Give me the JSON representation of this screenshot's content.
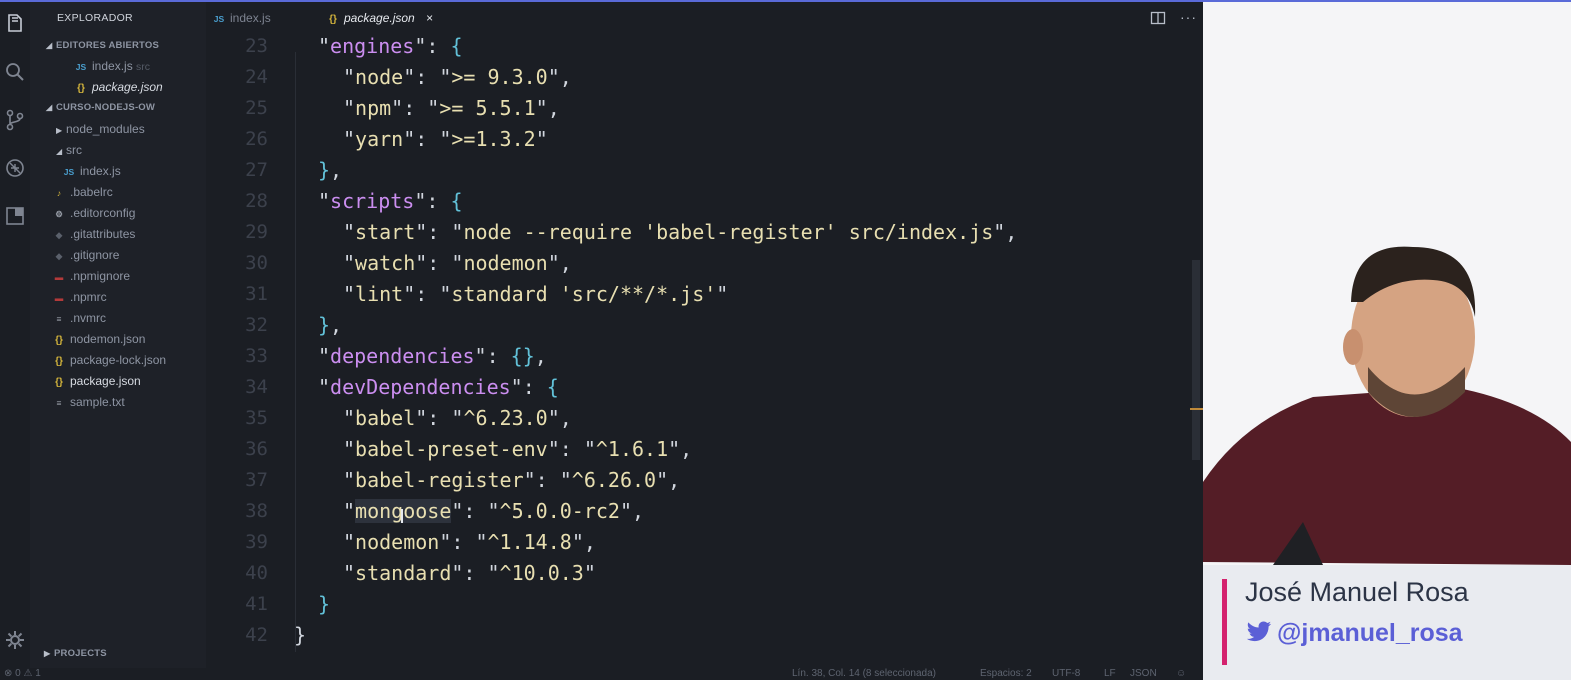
{
  "sidebar": {
    "title": "EXPLORADOR",
    "open_editors": {
      "label": "EDITORES ABIERTOS",
      "items": [
        {
          "icon": "js-file-icon",
          "name": "index.js",
          "detail": "src"
        },
        {
          "icon": "json-file-icon",
          "name": "package.json"
        }
      ]
    },
    "project": {
      "label": "CURSO-NODEJS-OW",
      "items": [
        {
          "name": "node_modules"
        },
        {
          "name": "src"
        },
        {
          "name": "index.js"
        },
        {
          "name": ".babelrc"
        },
        {
          "name": ".editorconfig"
        },
        {
          "name": ".gitattributes"
        },
        {
          "name": ".gitignore"
        },
        {
          "name": ".npmignore"
        },
        {
          "name": ".npmrc"
        },
        {
          "name": ".nvmrc"
        },
        {
          "name": "nodemon.json"
        },
        {
          "name": "package-lock.json"
        },
        {
          "name": "package.json"
        },
        {
          "name": "sample.txt"
        }
      ]
    },
    "projects_label": "PROJECTS"
  },
  "tabs": [
    {
      "label": "index.js",
      "icon": "js-file-icon",
      "active": false
    },
    {
      "label": "package.json",
      "icon": "json-file-icon",
      "active": true
    }
  ],
  "editor": {
    "lines": [
      {
        "num": "23",
        "code": "\"engines\": {"
      },
      {
        "num": "24",
        "code": "\"node\": \">= 9.3.0\","
      },
      {
        "num": "25",
        "code": "\"npm\": \">= 5.5.1\","
      },
      {
        "num": "26",
        "code": "\"yarn\": \">=1.3.2\""
      },
      {
        "num": "27",
        "code": "},"
      },
      {
        "num": "28",
        "code": "\"scripts\": {"
      },
      {
        "num": "29",
        "code": "\"start\": \"node --require 'babel-register' src/index.js\","
      },
      {
        "num": "30",
        "code": "\"watch\": \"nodemon\","
      },
      {
        "num": "31",
        "code": "\"lint\": \"standard 'src/**/*.js'\""
      },
      {
        "num": "32",
        "code": "},"
      },
      {
        "num": "33",
        "code": "\"dependencies\": {},"
      },
      {
        "num": "34",
        "code": "\"devDependencies\": {"
      },
      {
        "num": "35",
        "code": "\"babel\": \"^6.23.0\","
      },
      {
        "num": "36",
        "code": "\"babel-preset-env\": \"^1.6.1\","
      },
      {
        "num": "37",
        "code": "\"babel-register\": \"^6.26.0\","
      },
      {
        "num": "38",
        "code": "\"mongoose\": \"^5.0.0-rc2\","
      },
      {
        "num": "39",
        "code": "\"nodemon\": \"^1.14.8\","
      },
      {
        "num": "40",
        "code": "\"standard\": \"^10.0.3\""
      },
      {
        "num": "41",
        "code": "}"
      },
      {
        "num": "42",
        "code": "}"
      }
    ]
  },
  "status": {
    "problems": "0",
    "warnings": "1",
    "position": "Lín. 38, Col. 14 (8 seleccionada)",
    "spaces": "Espacios: 2",
    "encoding": "UTF-8",
    "eol": "LF",
    "language": "JSON"
  },
  "overlay": {
    "presenter_name": "José Manuel Rosa",
    "handle": "@jmanuel_rosa"
  },
  "colors": {
    "accent": "#5a6ad8",
    "key": "#cb8ef0",
    "value": "#e8dfb1",
    "brace": "#62c1d8",
    "nameplate_bar": "#d4226e",
    "handle": "#5b5fd6"
  }
}
